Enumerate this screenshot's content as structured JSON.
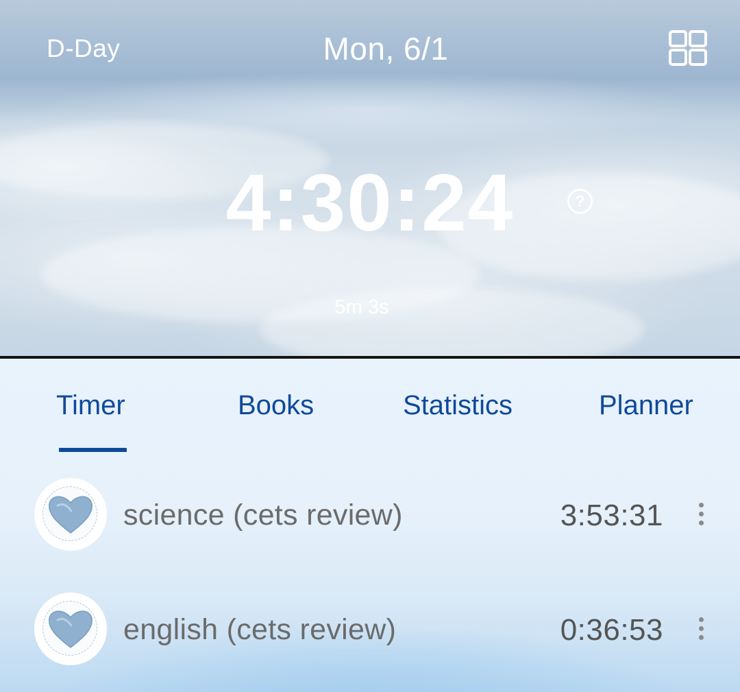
{
  "header": {
    "dday_label": "D-Day",
    "date": "Mon, 6/1",
    "grid_icon": "grid-menu-icon"
  },
  "timer": {
    "total": "4:30:24",
    "help_icon": "question-circle-icon",
    "help_glyph": "?",
    "session": "5m 3s"
  },
  "tabs": [
    {
      "label": "Timer",
      "active": true
    },
    {
      "label": "Books",
      "active": false
    },
    {
      "label": "Statistics",
      "active": false
    },
    {
      "label": "Planner",
      "active": false
    }
  ],
  "subjects": [
    {
      "icon": "heart-icon",
      "name": "science (cets review)",
      "time": "3:53:31",
      "menu_icon": "more-vertical-icon"
    },
    {
      "icon": "heart-icon",
      "name": "english (cets review)",
      "time": "0:36:53",
      "menu_icon": "more-vertical-icon"
    }
  ],
  "colors": {
    "accent": "#0e4a9a",
    "subject_text": "#6b6b6b",
    "timer_text": "#ffffff",
    "heart": "#8fb0cf"
  }
}
